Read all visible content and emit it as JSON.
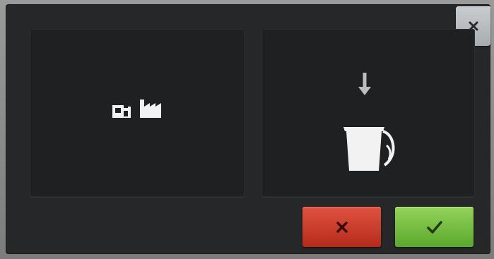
{
  "dialog": {
    "close_button": {
      "icon": "close-icon",
      "color": "#2a2a2a"
    },
    "left_panel": {
      "icons": [
        "machine-icon",
        "factory-icon"
      ]
    },
    "right_panel": {
      "icons": [
        "arrow-down-icon",
        "pitcher-icon"
      ]
    },
    "actions": {
      "cancel": {
        "icon": "x-icon",
        "color": "#c9321f"
      },
      "confirm": {
        "icon": "checkmark-icon",
        "color": "#6dbb3c"
      }
    }
  },
  "colors": {
    "background": "#262728",
    "panel": "#1f2021",
    "icon": "#f2f2f2"
  }
}
